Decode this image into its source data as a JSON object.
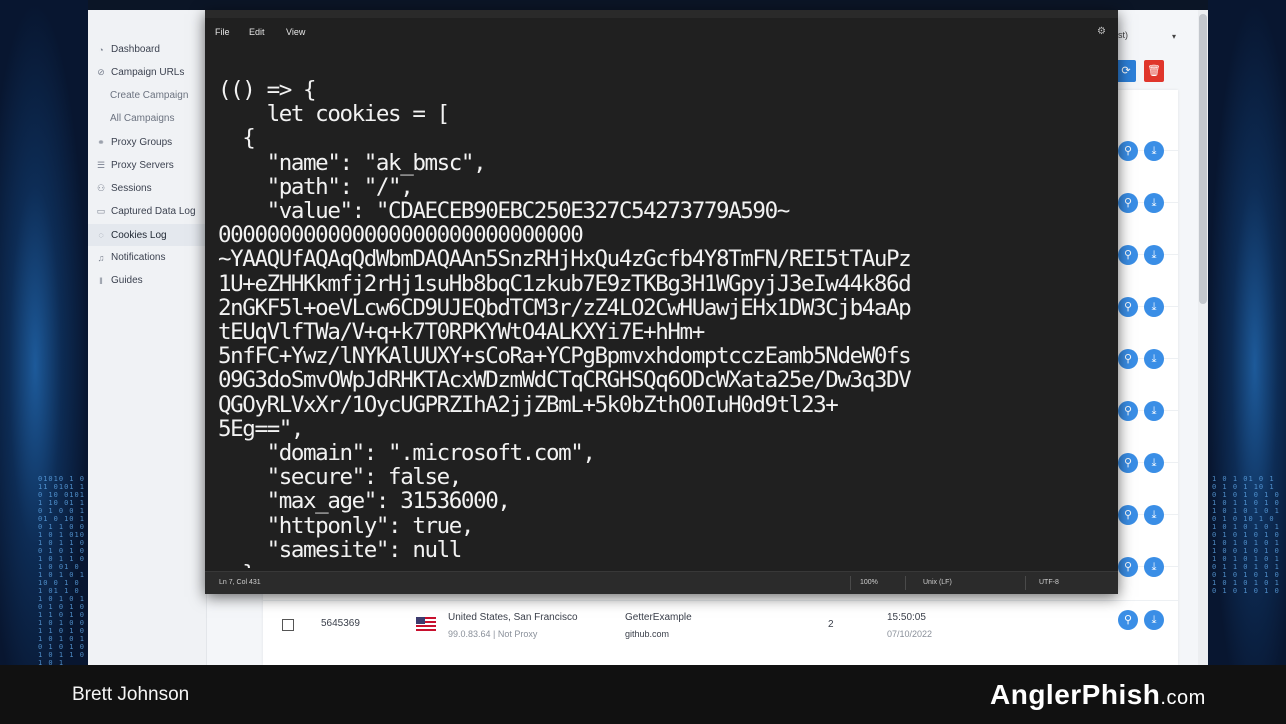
{
  "sidebar": {
    "items": [
      {
        "label": "Dashboard",
        "icon": "dashboard-icon"
      },
      {
        "label": "Campaign URLs",
        "icon": "link-icon"
      },
      {
        "label": "Create Campaign",
        "sub": true
      },
      {
        "label": "All Campaigns",
        "sub": true
      },
      {
        "label": "Proxy Groups",
        "icon": "proxy-groups-icon"
      },
      {
        "label": "Proxy Servers",
        "icon": "server-icon"
      },
      {
        "label": "Sessions",
        "icon": "sessions-icon"
      },
      {
        "label": "Captured Data Log",
        "icon": "captured-data-icon"
      },
      {
        "label": "Cookies Log",
        "icon": "cookie-icon",
        "active": true
      },
      {
        "label": "Notifications",
        "icon": "bell-icon"
      },
      {
        "label": "Guides",
        "icon": "guides-icon"
      }
    ]
  },
  "header": {
    "select_value": "st)"
  },
  "table": {
    "last_row": {
      "id": "5645369",
      "location": "United States, San Francisco",
      "ip": "99.0.83.64 | Not Proxy",
      "campaign": "GetterExample",
      "domain": "github.com",
      "count": "2",
      "time": "15:50:05",
      "date": "07/10/2022"
    }
  },
  "editor": {
    "menu": [
      "File",
      "Edit",
      "View"
    ],
    "code_lines": [
      "(() => {",
      "    let cookies = [",
      "  {",
      "    \"name\": \"ak_bmsc\",",
      "    \"path\": \"/\",",
      "    \"value\": \"CDAECEB90EBC250E327C54273779A590~",
      "000000000000000000000000000000",
      "~YAAQUfAQAqQdWbmDAQAAn5SnzRHjHxQu4zGcfb4Y8TmFN/REI5tTAuPz",
      "1U+eZHHKkmfj2rHj1suHb8bqC1zkub7E9zTKBg3H1WGpyjJ3eIw44k86d",
      "2nGKF5l+oeVLcw6CD9UJEQbdTCM3r/zZ4LO2CwHUawjEHx1DW3Cjb4aAp",
      "tEUqVlfTWa/V+q+k7T0RPKYWtO4ALKXYi7E+hHm+",
      "5nfFC+Ywz/lNYKAlUUXY+sCoRa+YCPgBpmvxhdomptcczEamb5NdeW0fs",
      "09G3doSmvOWpJdRHKTAcxWDzmWdCTqCRGHSQq6ODcWXata25e/Dw3q3DV",
      "QGOyRLVxXr/1OycUGPRZIhA2jjZBmL+5k0bZthO0IuH0d9tl23+",
      "5Eg==\",",
      "    \"domain\": \".microsoft.com\",",
      "    \"secure\": false,",
      "    \"max_age\": 31536000,",
      "    \"httponly\": true,",
      "    \"samesite\": null",
      "  }"
    ],
    "status": {
      "position": "Ln 7, Col 431",
      "zoom": "100%",
      "line_ending": "Unix (LF)",
      "encoding": "UTF-8"
    }
  },
  "footer": {
    "presenter": "Brett Johnson",
    "brand": "AnglerPhish",
    "brand_suffix": ".com"
  }
}
